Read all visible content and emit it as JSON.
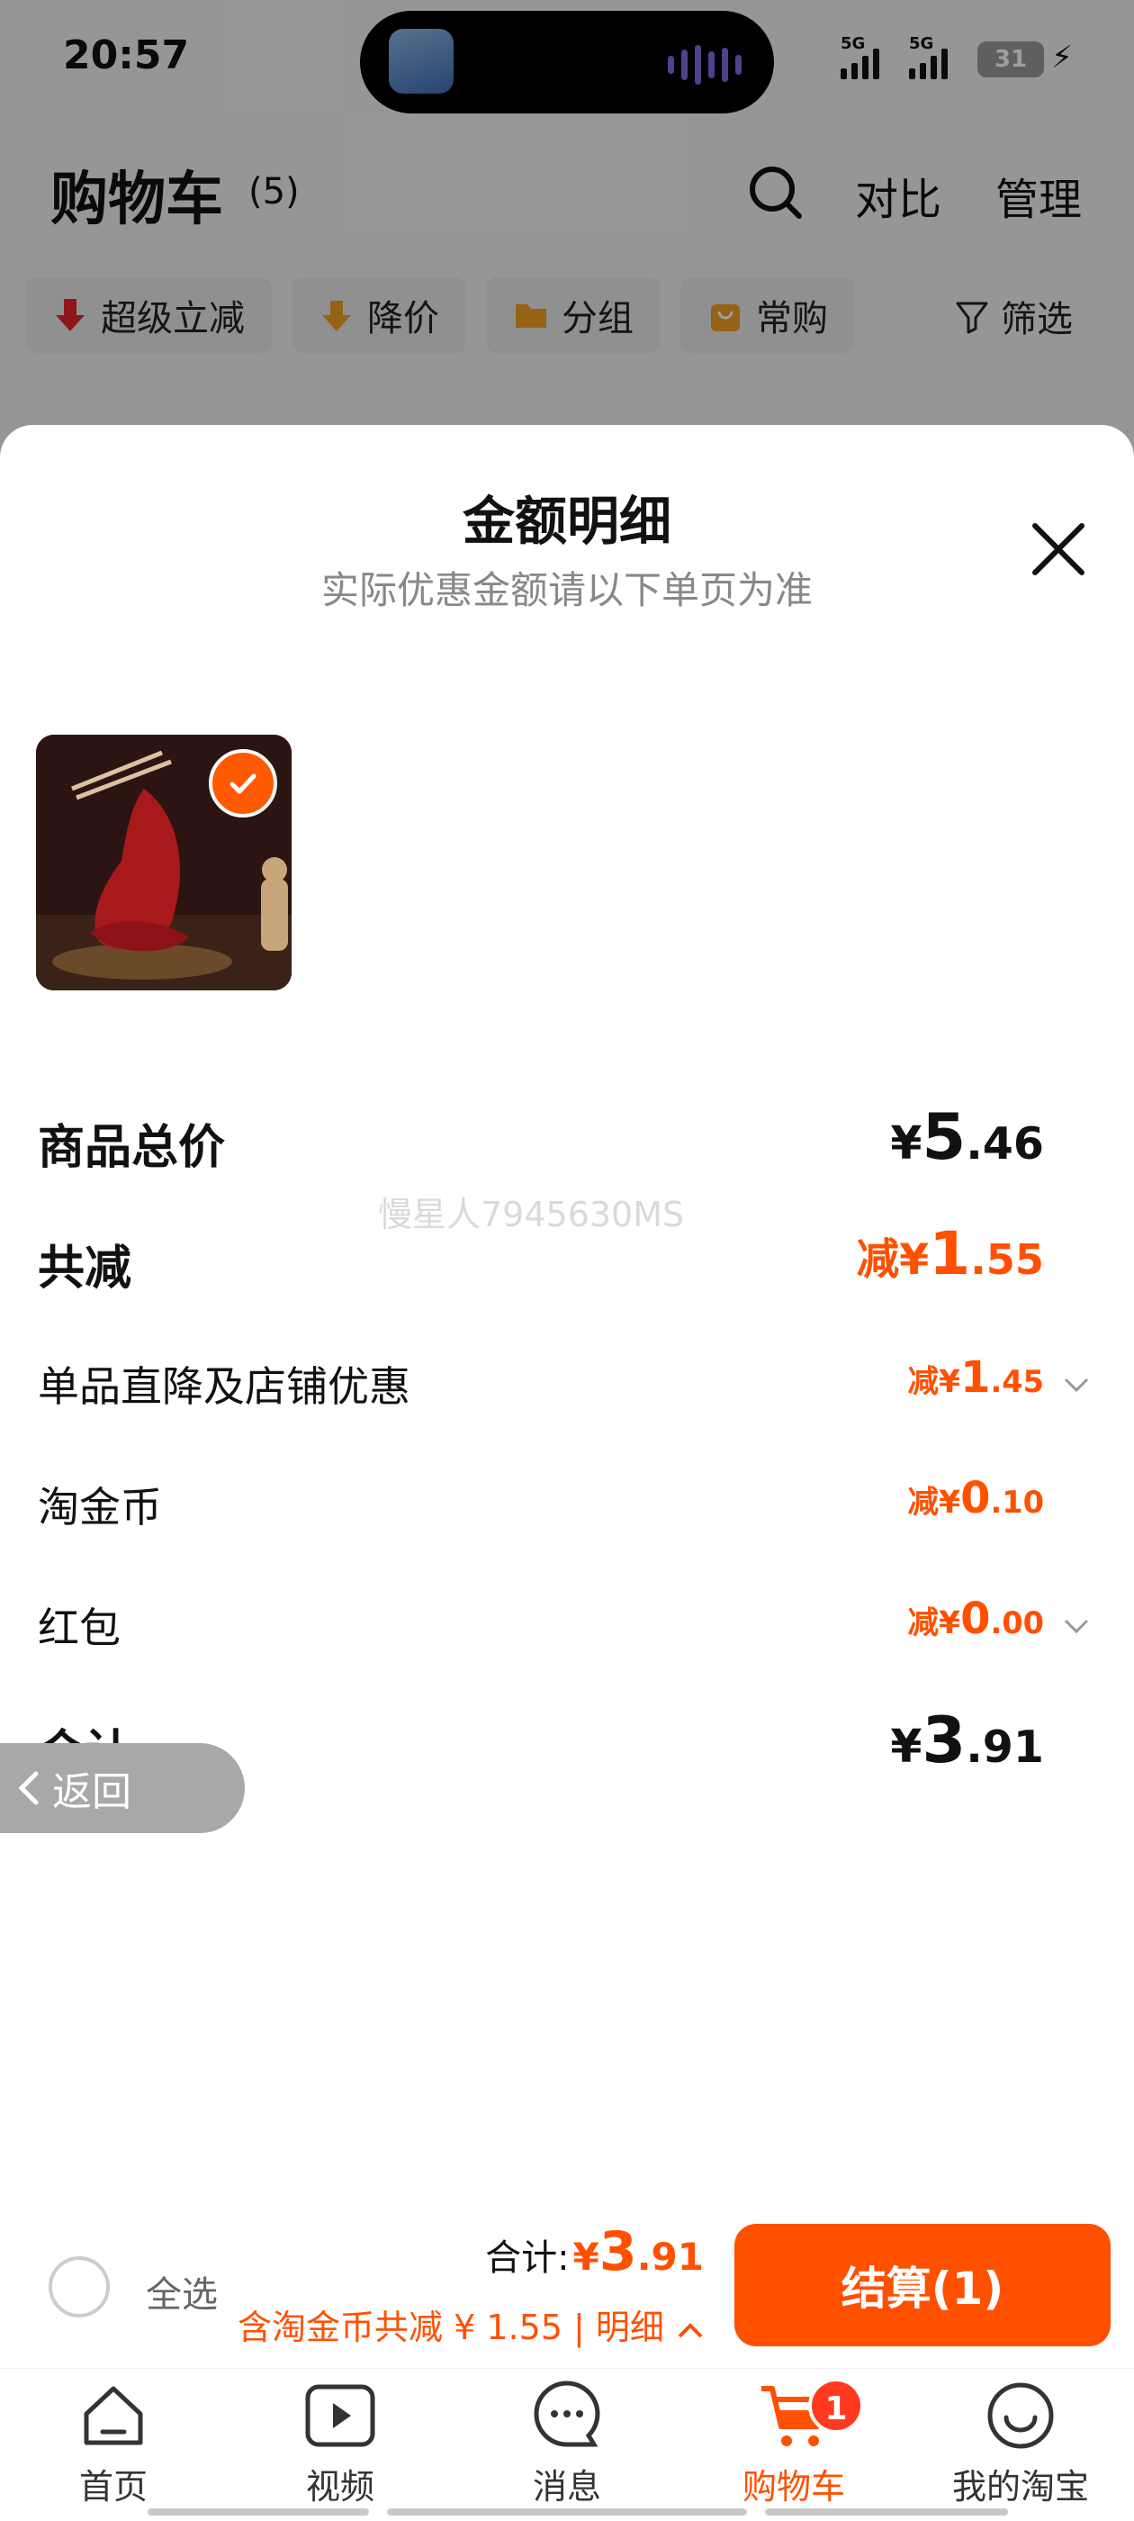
{
  "status_bar": {
    "time": "20:57",
    "network_1": "5G",
    "network_2": "5G",
    "battery": "31"
  },
  "cart_header": {
    "title": "购物车",
    "count": "(5)",
    "compare": "对比",
    "manage": "管理"
  },
  "filters": {
    "chips": [
      "超级立减",
      "降价",
      "分组",
      "常购"
    ],
    "filter_button": "筛选"
  },
  "sheet": {
    "title": "金额明细",
    "subtitle": "实际优惠金额请以下单页为准",
    "rows": {
      "total_price": {
        "label": "商品总价",
        "yen": "¥",
        "int": "5",
        "dec": ".46"
      },
      "total_reduction": {
        "label": "共减",
        "prefix": "减¥",
        "int": "1",
        "dec": ".55"
      },
      "shop_discount": {
        "label": "单品直降及店铺优惠",
        "prefix": "减¥",
        "int": "1",
        "dec": ".45"
      },
      "tao_coin": {
        "label": "淘金币",
        "prefix": "减¥",
        "int": "0",
        "dec": ".10"
      },
      "red_packet": {
        "label": "红包",
        "prefix": "减¥",
        "int": "0",
        "dec": ".00"
      },
      "sum": {
        "label": "合计",
        "yen": "¥",
        "int": "3",
        "dec": ".91"
      }
    },
    "watermark": "慢星人7945630MS"
  },
  "back_button": "返回",
  "checkout_bar": {
    "select_all": "全选",
    "total_prefix": "合计:",
    "total_yen": "¥",
    "total_int": "3",
    "total_dec": ".91",
    "saving_text": "含淘金币共减 ¥ 1.55 | 明细",
    "checkout_label": "结算(1)"
  },
  "tab_bar": {
    "tabs": [
      {
        "label": "首页",
        "icon": "home-icon"
      },
      {
        "label": "视频",
        "icon": "video-icon"
      },
      {
        "label": "消息",
        "icon": "message-icon"
      },
      {
        "label": "购物车",
        "icon": "cart-icon",
        "badge": "1"
      },
      {
        "label": "我的淘宝",
        "icon": "profile-icon"
      }
    ]
  },
  "colors": {
    "accent": "#ff5000",
    "badge": "#ff3a1e",
    "muted_text": "#888888"
  }
}
